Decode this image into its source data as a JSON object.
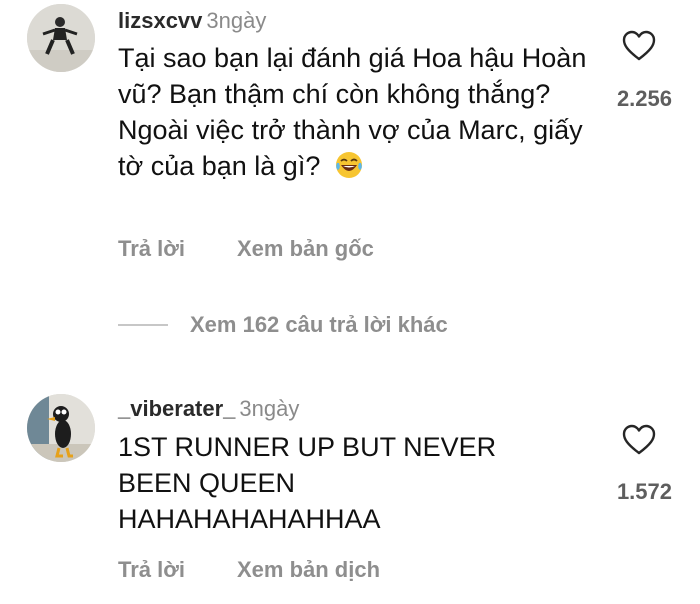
{
  "comments": [
    {
      "username": "lizsxcvv",
      "time": "3ngày",
      "text": "Tại sao bạn lại đánh giá Hoa hậu Hoàn vũ? Bạn thậm chí còn không thắng? Ngoài việc trở thành vợ của Marc, giấy tờ của bạn là gì?",
      "emoji": "laughing-tears-emoji",
      "likes": "2.256",
      "reply_label": "Trả lời",
      "secondary_label": "Xem bản gốc"
    },
    {
      "username": "_viberater_",
      "time": "3ngày",
      "text": "1ST RUNNER UP BUT NEVER BEEN QUEEN HAHAHAHAHAHHAA",
      "likes": "1.572",
      "reply_label": "Trả lời",
      "secondary_label": "Xem bản dịch"
    }
  ],
  "more_replies_label": "Xem 162 câu trả lời khác",
  "icons": {
    "heart": "heart-outline-icon"
  },
  "colors": {
    "text": "#111111",
    "muted": "#8e8e8e",
    "likes": "#5e5e5e"
  }
}
